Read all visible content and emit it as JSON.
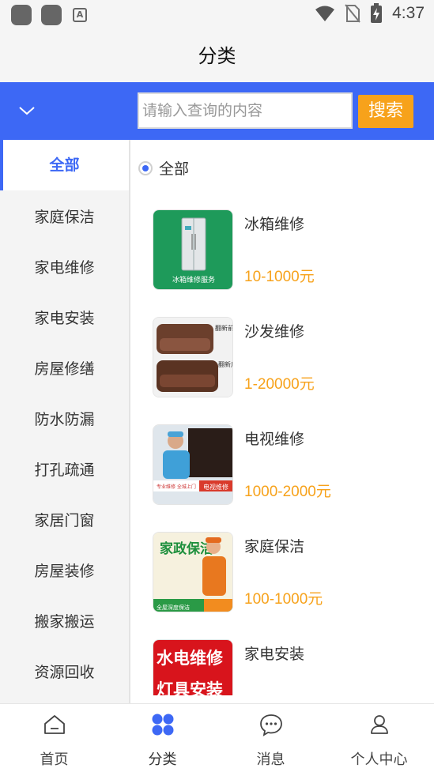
{
  "status_bar": {
    "time": "4:37",
    "icons": [
      "app-icon",
      "app-icon",
      "a-icon",
      "wifi-icon",
      "no-sim-icon",
      "battery-charging-icon"
    ]
  },
  "page": {
    "title": "分类"
  },
  "search": {
    "placeholder": "请输入查询的内容",
    "button_label": "搜索"
  },
  "sidebar": {
    "items": [
      {
        "label": "全部",
        "active": true
      },
      {
        "label": "家庭保洁"
      },
      {
        "label": "家电维修"
      },
      {
        "label": "家电安装"
      },
      {
        "label": "房屋修缮"
      },
      {
        "label": "防水防漏"
      },
      {
        "label": "打孔疏通"
      },
      {
        "label": "家居门窗"
      },
      {
        "label": "房屋装修"
      },
      {
        "label": "搬家搬运"
      },
      {
        "label": "资源回收"
      }
    ]
  },
  "filter": {
    "label": "全部",
    "selected": true
  },
  "products": [
    {
      "name": "冰箱维修",
      "price": "10-1000元",
      "thumb_caption": "冰箱维修服务"
    },
    {
      "name": "沙发维修",
      "price": "1-20000元",
      "thumb_caption": "翻新前",
      "thumb_caption2": "翻新后"
    },
    {
      "name": "电视维修",
      "price": "1000-2000元",
      "thumb_caption": "专业维修 全城上门",
      "thumb_caption2": "电视维修"
    },
    {
      "name": "家庭保洁",
      "price": "100-1000元",
      "thumb_caption": "家政保洁",
      "thumb_caption2": "全屋深度保洁"
    },
    {
      "name": "家电安装",
      "price": "",
      "thumb_caption": "水电维修",
      "thumb_caption2": "灯具安装"
    }
  ],
  "bottom_nav": {
    "items": [
      {
        "label": "首页",
        "icon": "home-icon"
      },
      {
        "label": "分类",
        "icon": "category-icon",
        "active": true
      },
      {
        "label": "消息",
        "icon": "message-icon"
      },
      {
        "label": "个人中心",
        "icon": "user-icon"
      }
    ]
  },
  "colors": {
    "primary": "#3d68f5",
    "accent": "#f7a21b"
  }
}
